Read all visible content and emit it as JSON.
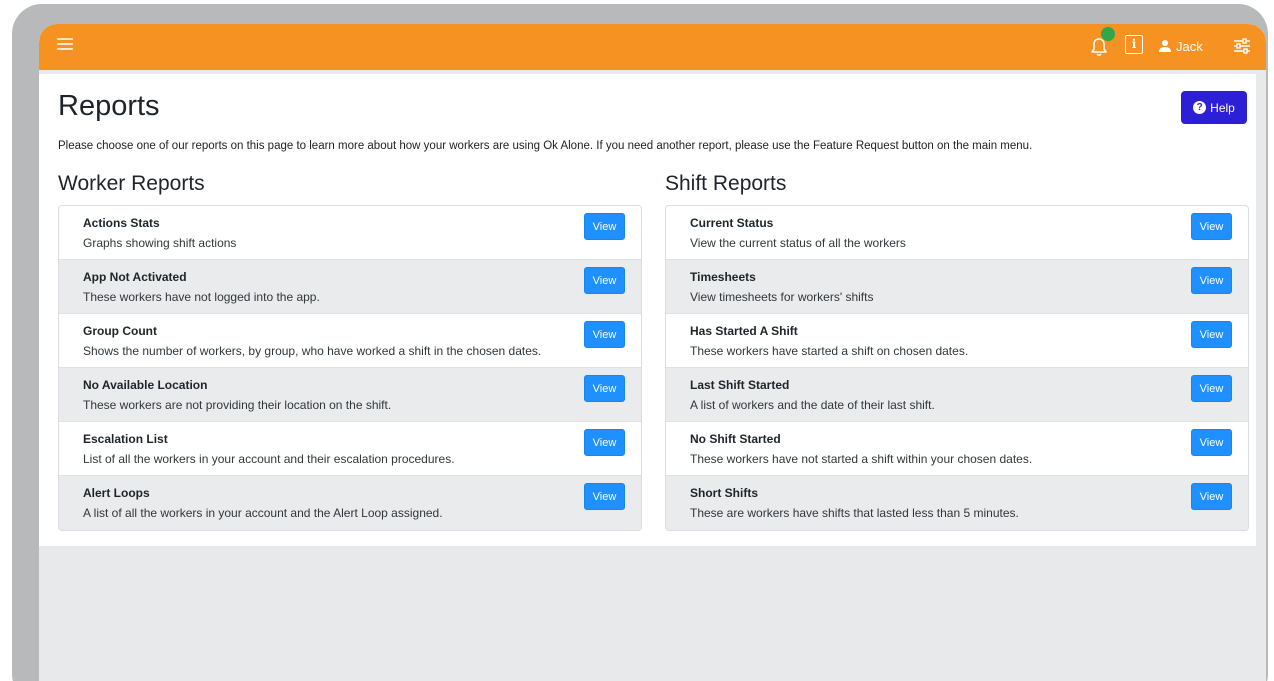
{
  "header": {
    "user_name": "Jack",
    "info_label": "i"
  },
  "page": {
    "title": "Reports",
    "help_label": "Help",
    "intro": "Please choose one of our reports on this page to learn more about how your workers are using Ok Alone. If you need another report, please use the Feature Request button on the main menu."
  },
  "worker_reports": {
    "title": "Worker Reports",
    "items": [
      {
        "title": "Actions Stats",
        "desc": "Graphs showing shift actions",
        "button": "View"
      },
      {
        "title": "App Not Activated",
        "desc": "These workers have not logged into the app.",
        "button": "View"
      },
      {
        "title": "Group Count",
        "desc": "Shows the number of workers, by group, who have worked a shift in the chosen dates.",
        "button": "View"
      },
      {
        "title": "No Available Location",
        "desc": "These workers are not providing their location on the shift.",
        "button": "View"
      },
      {
        "title": "Escalation List",
        "desc": "List of all the workers in your account and their escalation procedures.",
        "button": "View"
      },
      {
        "title": "Alert Loops",
        "desc": "A list of all the workers in your account and the Alert Loop assigned.",
        "button": "View"
      }
    ]
  },
  "shift_reports": {
    "title": "Shift Reports",
    "items": [
      {
        "title": "Current Status",
        "desc": "View the current status of all the workers",
        "button": "View"
      },
      {
        "title": "Timesheets",
        "desc": "View timesheets for workers' shifts",
        "button": "View"
      },
      {
        "title": "Has Started A Shift",
        "desc": "These workers have started a shift on chosen dates.",
        "button": "View"
      },
      {
        "title": "Last Shift Started",
        "desc": "A list of workers and the date of their last shift.",
        "button": "View"
      },
      {
        "title": "No Shift Started",
        "desc": "These workers have not started a shift within your chosen dates.",
        "button": "View"
      },
      {
        "title": "Short Shifts",
        "desc": "These are workers have shifts that lasted less than 5 minutes.",
        "button": "View"
      }
    ]
  },
  "colors": {
    "topbar": "#f59222",
    "help_button": "#2d1fd6",
    "view_button": "#1e90ff",
    "notification_dot": "#2ea84b"
  },
  "icons": [
    "menu-icon",
    "bell-icon",
    "info-icon",
    "user-icon",
    "sliders-icon",
    "question-icon"
  ]
}
